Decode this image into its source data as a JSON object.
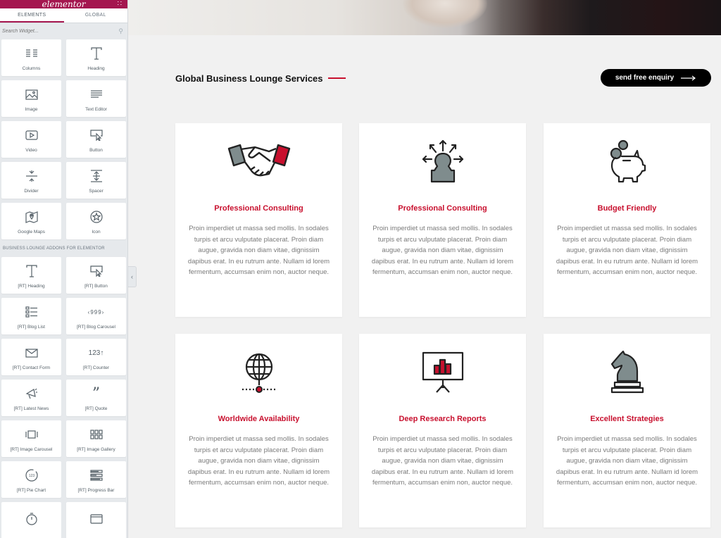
{
  "panel": {
    "logo": "elementor",
    "tabs": [
      "ELEMENTS",
      "GLOBAL"
    ],
    "search_placeholder": "Search Widget...",
    "basic_widgets": [
      {
        "label": "Columns",
        "icon": "columns-icon"
      },
      {
        "label": "Heading",
        "icon": "heading-icon"
      },
      {
        "label": "Image",
        "icon": "image-icon"
      },
      {
        "label": "Text Editor",
        "icon": "text-editor-icon"
      },
      {
        "label": "Video",
        "icon": "video-icon"
      },
      {
        "label": "Button",
        "icon": "button-icon"
      },
      {
        "label": "Divider",
        "icon": "divider-icon"
      },
      {
        "label": "Spacer",
        "icon": "spacer-icon"
      },
      {
        "label": "Google Maps",
        "icon": "map-icon"
      },
      {
        "label": "Icon",
        "icon": "star-icon"
      }
    ],
    "category_title": "BUSINESS LOUNGE ADDONS FOR ELEMENTOR",
    "addon_widgets": [
      {
        "label": "[RT] Heading",
        "icon": "heading-icon"
      },
      {
        "label": "[RT] Button",
        "icon": "button-icon"
      },
      {
        "label": "[RT] Blog List",
        "icon": "list-icon"
      },
      {
        "label": "[RT] Blog Carousel",
        "icon": "carousel-icon"
      },
      {
        "label": "[RT] Contact Form",
        "icon": "envelope-icon"
      },
      {
        "label": "[RT] Counter",
        "icon": "counter-icon"
      },
      {
        "label": "[RT] Latest News",
        "icon": "megaphone-icon"
      },
      {
        "label": "[RT] Quote",
        "icon": "quote-icon"
      },
      {
        "label": "[RT] Image Carousel",
        "icon": "image-carousel-icon"
      },
      {
        "label": "[RT] Image Gallery",
        "icon": "gallery-icon"
      },
      {
        "label": "[RT] Pie Chart",
        "icon": "pie-chart-icon"
      },
      {
        "label": "[RT] Progress Bar",
        "icon": "progress-bar-icon"
      },
      {
        "label": "",
        "icon": "stopwatch-icon"
      },
      {
        "label": "",
        "icon": "tabs-icon"
      }
    ]
  },
  "section": {
    "title": "Global Business Lounge Services",
    "enquiry_label": "send free enquiry"
  },
  "cards": [
    {
      "title": "Professional Consulting",
      "icon": "handshake-icon",
      "text": "Proin imperdiet ut massa sed mollis. In sodales turpis et arcu vulputate placerat. Proin diam augue, gravida non diam vitae, dignissim dapibus erat. In eu rutrum ante. Nullam id lorem fermentum, accumsan enim non, auctor neque."
    },
    {
      "title": "Professional Consulting",
      "icon": "person-arrows-icon",
      "text": "Proin imperdiet ut massa sed mollis. In sodales turpis et arcu vulputate placerat. Proin diam augue, gravida non diam vitae, dignissim dapibus erat. In eu rutrum ante. Nullam id lorem fermentum, accumsan enim non, auctor neque."
    },
    {
      "title": "Budget Friendly",
      "icon": "piggy-bank-icon",
      "text": "Proin imperdiet ut massa sed mollis. In sodales turpis et arcu vulputate placerat. Proin diam augue, gravida non diam vitae, dignissim dapibus erat. In eu rutrum ante. Nullam id lorem fermentum, accumsan enim non, auctor neque."
    },
    {
      "title": "Worldwide Availability",
      "icon": "globe-icon",
      "text": "Proin imperdiet ut massa sed mollis. In sodales turpis et arcu vulputate placerat. Proin diam augue, gravida non diam vitae, dignissim dapibus erat. In eu rutrum ante. Nullam id lorem fermentum, accumsan enim non, auctor neque."
    },
    {
      "title": "Deep Research Reports",
      "icon": "presentation-chart-icon",
      "text": "Proin imperdiet ut massa sed mollis. In sodales turpis et arcu vulputate placerat. Proin diam augue, gravida non diam vitae, dignissim dapibus erat. In eu rutrum ante. Nullam id lorem fermentum, accumsan enim non, auctor neque."
    },
    {
      "title": "Excellent Strategies",
      "icon": "chess-knight-icon",
      "text": "Proin imperdiet ut massa sed mollis. In sodales turpis et arcu vulputate placerat. Proin diam augue, gravida non diam vitae, dignissim dapibus erat. In eu rutrum ante. Nullam id lorem fermentum, accumsan enim non, auctor neque."
    }
  ],
  "colors": {
    "brand": "#a4164f",
    "accent": "#c8102e",
    "icon_gray": "#7f8c8d",
    "icon_stroke": "#222222"
  }
}
